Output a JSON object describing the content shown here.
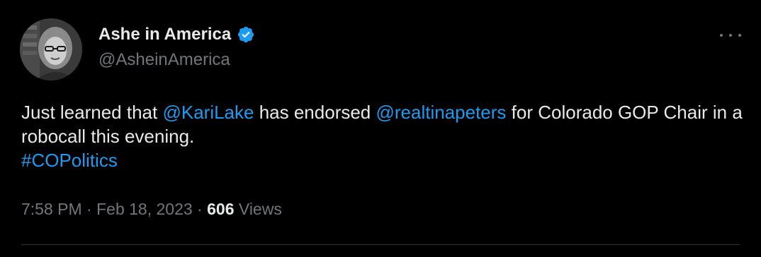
{
  "author": {
    "display_name": "Ashe in America",
    "handle": "@AsheinAmerica",
    "verified_icon": "verified-badge-icon",
    "avatar": "profile-photo",
    "verified_color": "#1d9bf0"
  },
  "tweet": {
    "text_1": "Just learned that ",
    "mention_1": "@KariLake",
    "text_2": " has endorsed ",
    "mention_2": "@realtinapeters",
    "text_3": " for Colorado GOP Chair in a robocall this evening.",
    "hashtag": "#COPolitics"
  },
  "meta": {
    "time": "7:58 PM",
    "separator_1": " · ",
    "date": "Feb 18, 2023",
    "separator_2": " · ",
    "views_count": "606",
    "views_label": " Views"
  },
  "menu": {
    "icon": "more-options-icon"
  },
  "colors": {
    "background": "#000000",
    "text": "#e7e9ea",
    "secondary": "#71767b",
    "link": "#1d9bf0"
  }
}
